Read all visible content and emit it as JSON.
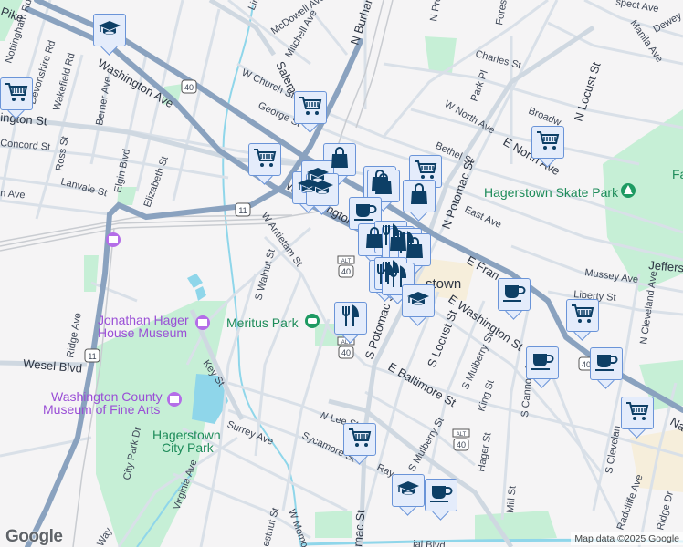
{
  "map": {
    "streets": {
      "washington_ave": "Washington Ave",
      "w_washington_st": "W Washington St",
      "washington_st_left": "ington St",
      "nottingham_rd": "Nottingham Rd",
      "devonshire_rd": "Devonshire Rd",
      "wakefield_rd": "Wakefield Rd",
      "berner_ave": "Berner Ave",
      "concord_st": "Concord St",
      "ross_st": "Ross St",
      "elgin_blvd": "Elgin Blvd",
      "lanvale_st": "Lanvale St",
      "elizabeth_st": "Elizabeth St",
      "n_ave_left": "n Ave",
      "pike": "Pike",
      "mcdowell_ave": "McDowell Ave",
      "mitchell_ave": "Mitchell Ave",
      "ling": "Ling",
      "salem": "Salem",
      "w_church_st": "W Church St",
      "george_st": "George St",
      "w_antietam_st": "W Antietam St",
      "s_walnut_st": "S Walnut St",
      "n_burhans": "N Burhans",
      "n_pro": "N Pro",
      "forest": "Forest",
      "charles_st": "Charles St",
      "park_pl": "Park Pl",
      "w_north_ave": "W North Ave",
      "e_north_ave": "E North Ave",
      "bethel_st": "Bethel St",
      "n_potomac_st": "N Potomac St",
      "east_ave": "East Ave",
      "broadway": "Broadw",
      "n_locust_st": "N Locust St",
      "manila_ave": "Manila Ave",
      "dewey": "Dewey",
      "prospect_ave": "spect Ave",
      "e_franklin": "E Fran",
      "jefferson": "Jeffers",
      "mussey_ave": "Mussey Ave",
      "liberty_st": "Liberty St",
      "n_cleveland_ave": "N Cleveland Ave",
      "e_washington_st": "E Washington St",
      "s_potomac_st": "S Potomac St",
      "s_locust_st": "S Locust St",
      "s_mulberry_st": "S Mulberry St",
      "s_mulberry_st_2": "S Mulberry St",
      "e_baltimore_st": "E Baltimore St",
      "king_st": "King St",
      "hager_st": "Hager St",
      "s_cannon_ave": "S Cannon Av",
      "mill_st": "Mill St",
      "s_cleveland": "S Clevelan",
      "radcliffe_ave": "Radcliffe Ave",
      "ridge_dr": "Ridge Dr",
      "national": "Na",
      "ray": "Ray",
      "w_lee_st": "W Lee St",
      "sycamore_st": "Sycamore St",
      "surrey_ave": "Surrey Ave",
      "key_st": "Key St",
      "virginia_ave": "Virginia Ave",
      "city_park_dr": "City Park Dr",
      "ridge_ave": "Ridge Ave",
      "wesel_blvd": "Wesel Blvd",
      "chestnut_st": "estnut St",
      "w_memorial_blvd": "W Memorial Bl",
      "memorial_blvd_e": "ial Blvd",
      "s_potomac_bottom": "mac St",
      "way": "Way"
    },
    "places": {
      "hagerstown": "stown",
      "skate_park": "Hagerstown Skate Park",
      "meritus_park": "Meritus Park",
      "hager_house": [
        "Jonathan Hager",
        "House Museum"
      ],
      "museum_fine_arts": [
        "Washington County",
        "Museum of Fine Arts"
      ],
      "city_park": [
        "Hagerstown",
        "City Park"
      ],
      "fairgrounds": "Fa"
    },
    "route_shields": {
      "us40": "40",
      "us11": "11",
      "alt": "ALT"
    },
    "markers": [
      "school",
      "grocery",
      "grocery",
      "grocery",
      "shopping",
      "grocery",
      "grocery",
      "school",
      "school",
      "school",
      "shopping",
      "shopping",
      "shopping",
      "coffee",
      "shopping",
      "restaurant",
      "shopping",
      "restaurant",
      "shopping",
      "restaurant",
      "restaurant",
      "restaurant",
      "coffee",
      "grocery",
      "school",
      "restaurant",
      "coffee",
      "coffee",
      "grocery",
      "grocery",
      "school",
      "coffee"
    ],
    "attribution": "Map data ©2025 Google",
    "logo": "Google",
    "colors": {
      "background": "#f5f4f5",
      "highway": "#8aa2bf",
      "road": "#d5dde6",
      "park": "#c6efd6",
      "water": "#8fd6ea",
      "marker_fill": "#e4ecfb",
      "marker_border": "#6a94d8",
      "icon": "#0d3f66"
    }
  }
}
